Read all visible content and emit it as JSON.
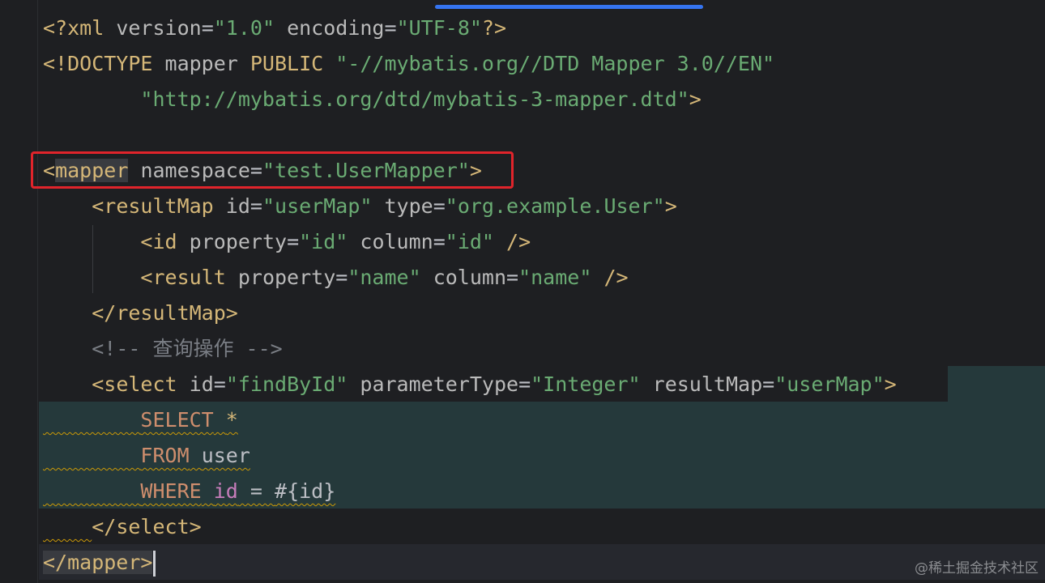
{
  "lines": [
    {
      "tokens": [
        {
          "t": "<?",
          "c": "tag"
        },
        {
          "t": "xml ",
          "c": "tag"
        },
        {
          "t": "version",
          "c": "attr"
        },
        {
          "t": "=",
          "c": "punct"
        },
        {
          "t": "\"1.0\"",
          "c": "val"
        },
        {
          "t": " ",
          "c": "punct"
        },
        {
          "t": "encoding",
          "c": "attr"
        },
        {
          "t": "=",
          "c": "punct"
        },
        {
          "t": "\"UTF-8\"",
          "c": "val"
        },
        {
          "t": "?>",
          "c": "tag"
        }
      ]
    },
    {
      "tokens": [
        {
          "t": "<!DOCTYPE ",
          "c": "tag"
        },
        {
          "t": "mapper ",
          "c": "attr"
        },
        {
          "t": "PUBLIC ",
          "c": "tag"
        },
        {
          "t": "\"-//mybatis.org//DTD Mapper 3.0//EN\"",
          "c": "val"
        }
      ]
    },
    {
      "tokens": [
        {
          "t": "        ",
          "c": "punct"
        },
        {
          "t": "\"http://mybatis.org/dtd/mybatis-3-mapper.dtd\"",
          "c": "val"
        },
        {
          "t": ">",
          "c": "tag"
        }
      ]
    },
    {
      "tokens": []
    },
    {
      "tokens": [
        {
          "t": "<",
          "c": "tag"
        },
        {
          "t": "mapper",
          "c": "tag",
          "hl": true
        },
        {
          "t": " ",
          "c": "punct"
        },
        {
          "t": "namespace",
          "c": "attr"
        },
        {
          "t": "=",
          "c": "punct"
        },
        {
          "t": "\"test.UserMapper\"",
          "c": "val"
        },
        {
          "t": ">",
          "c": "tag"
        }
      ]
    },
    {
      "tokens": [
        {
          "t": "    ",
          "c": "punct"
        },
        {
          "t": "<resultMap ",
          "c": "tag"
        },
        {
          "t": "id",
          "c": "attr"
        },
        {
          "t": "=",
          "c": "punct"
        },
        {
          "t": "\"userMap\"",
          "c": "val"
        },
        {
          "t": " ",
          "c": "punct"
        },
        {
          "t": "type",
          "c": "attr"
        },
        {
          "t": "=",
          "c": "punct"
        },
        {
          "t": "\"org.example.User\"",
          "c": "val"
        },
        {
          "t": ">",
          "c": "tag"
        }
      ]
    },
    {
      "tokens": [
        {
          "t": "        ",
          "c": "punct"
        },
        {
          "t": "<id ",
          "c": "tag"
        },
        {
          "t": "property",
          "c": "attr"
        },
        {
          "t": "=",
          "c": "punct"
        },
        {
          "t": "\"id\"",
          "c": "val"
        },
        {
          "t": " ",
          "c": "punct"
        },
        {
          "t": "column",
          "c": "attr"
        },
        {
          "t": "=",
          "c": "punct"
        },
        {
          "t": "\"id\"",
          "c": "val"
        },
        {
          "t": " />",
          "c": "tag"
        }
      ]
    },
    {
      "tokens": [
        {
          "t": "        ",
          "c": "punct"
        },
        {
          "t": "<result ",
          "c": "tag"
        },
        {
          "t": "property",
          "c": "attr"
        },
        {
          "t": "=",
          "c": "punct"
        },
        {
          "t": "\"name\"",
          "c": "val"
        },
        {
          "t": " ",
          "c": "punct"
        },
        {
          "t": "column",
          "c": "attr"
        },
        {
          "t": "=",
          "c": "punct"
        },
        {
          "t": "\"name\"",
          "c": "val"
        },
        {
          "t": " />",
          "c": "tag"
        }
      ]
    },
    {
      "tokens": [
        {
          "t": "    ",
          "c": "punct"
        },
        {
          "t": "</resultMap>",
          "c": "tag"
        }
      ]
    },
    {
      "tokens": [
        {
          "t": "    ",
          "c": "punct"
        },
        {
          "t": "<!-- 查询操作 -->",
          "c": "comment"
        }
      ]
    },
    {
      "tokens": [
        {
          "t": "    ",
          "c": "punct"
        },
        {
          "t": "<select ",
          "c": "tag"
        },
        {
          "t": "id",
          "c": "attr"
        },
        {
          "t": "=",
          "c": "punct"
        },
        {
          "t": "\"findById\"",
          "c": "val"
        },
        {
          "t": " ",
          "c": "punct"
        },
        {
          "t": "parameterType",
          "c": "attr"
        },
        {
          "t": "=",
          "c": "punct"
        },
        {
          "t": "\"Integer\"",
          "c": "val"
        },
        {
          "t": " ",
          "c": "punct"
        },
        {
          "t": "resultMap",
          "c": "attr"
        },
        {
          "t": "=",
          "c": "punct"
        },
        {
          "t": "\"userMap\"",
          "c": "val"
        },
        {
          "t": ">",
          "c": "tag"
        }
      ]
    },
    {
      "tokens": [
        {
          "t": "        ",
          "c": "punct squig"
        },
        {
          "t": "SELECT",
          "c": "kw squig"
        },
        {
          "t": " ",
          "c": "punct squig"
        },
        {
          "t": "*",
          "c": "tag squig"
        }
      ]
    },
    {
      "tokens": [
        {
          "t": "        ",
          "c": "punct squig"
        },
        {
          "t": "FROM",
          "c": "kw squig"
        },
        {
          "t": " ",
          "c": "punct squig"
        },
        {
          "t": "user",
          "c": "ident squig"
        }
      ]
    },
    {
      "tokens": [
        {
          "t": "        ",
          "c": "punct squig"
        },
        {
          "t": "WHERE",
          "c": "kw squig"
        },
        {
          "t": " ",
          "c": "punct squig"
        },
        {
          "t": "id",
          "c": "param squig"
        },
        {
          "t": " = ",
          "c": "punct squig"
        },
        {
          "t": "#{id}",
          "c": "ident squig"
        }
      ]
    },
    {
      "tokens": [
        {
          "t": "    ",
          "c": "punct squig"
        },
        {
          "t": "</select>",
          "c": "tag"
        }
      ]
    },
    {
      "tokens": [
        {
          "t": "</mapper>",
          "c": "tag",
          "hl": true
        }
      ],
      "caret": true
    }
  ],
  "watermark": "@稀土掘金技术社区",
  "colors": {
    "background": "#1e1f22",
    "tag": "#d5b778",
    "attribute": "#bababa",
    "value": "#6aab73",
    "comment": "#7a7e85",
    "keyword": "#cf8e6d",
    "highlight_box": "#e0242b",
    "selection": "#25393b"
  }
}
